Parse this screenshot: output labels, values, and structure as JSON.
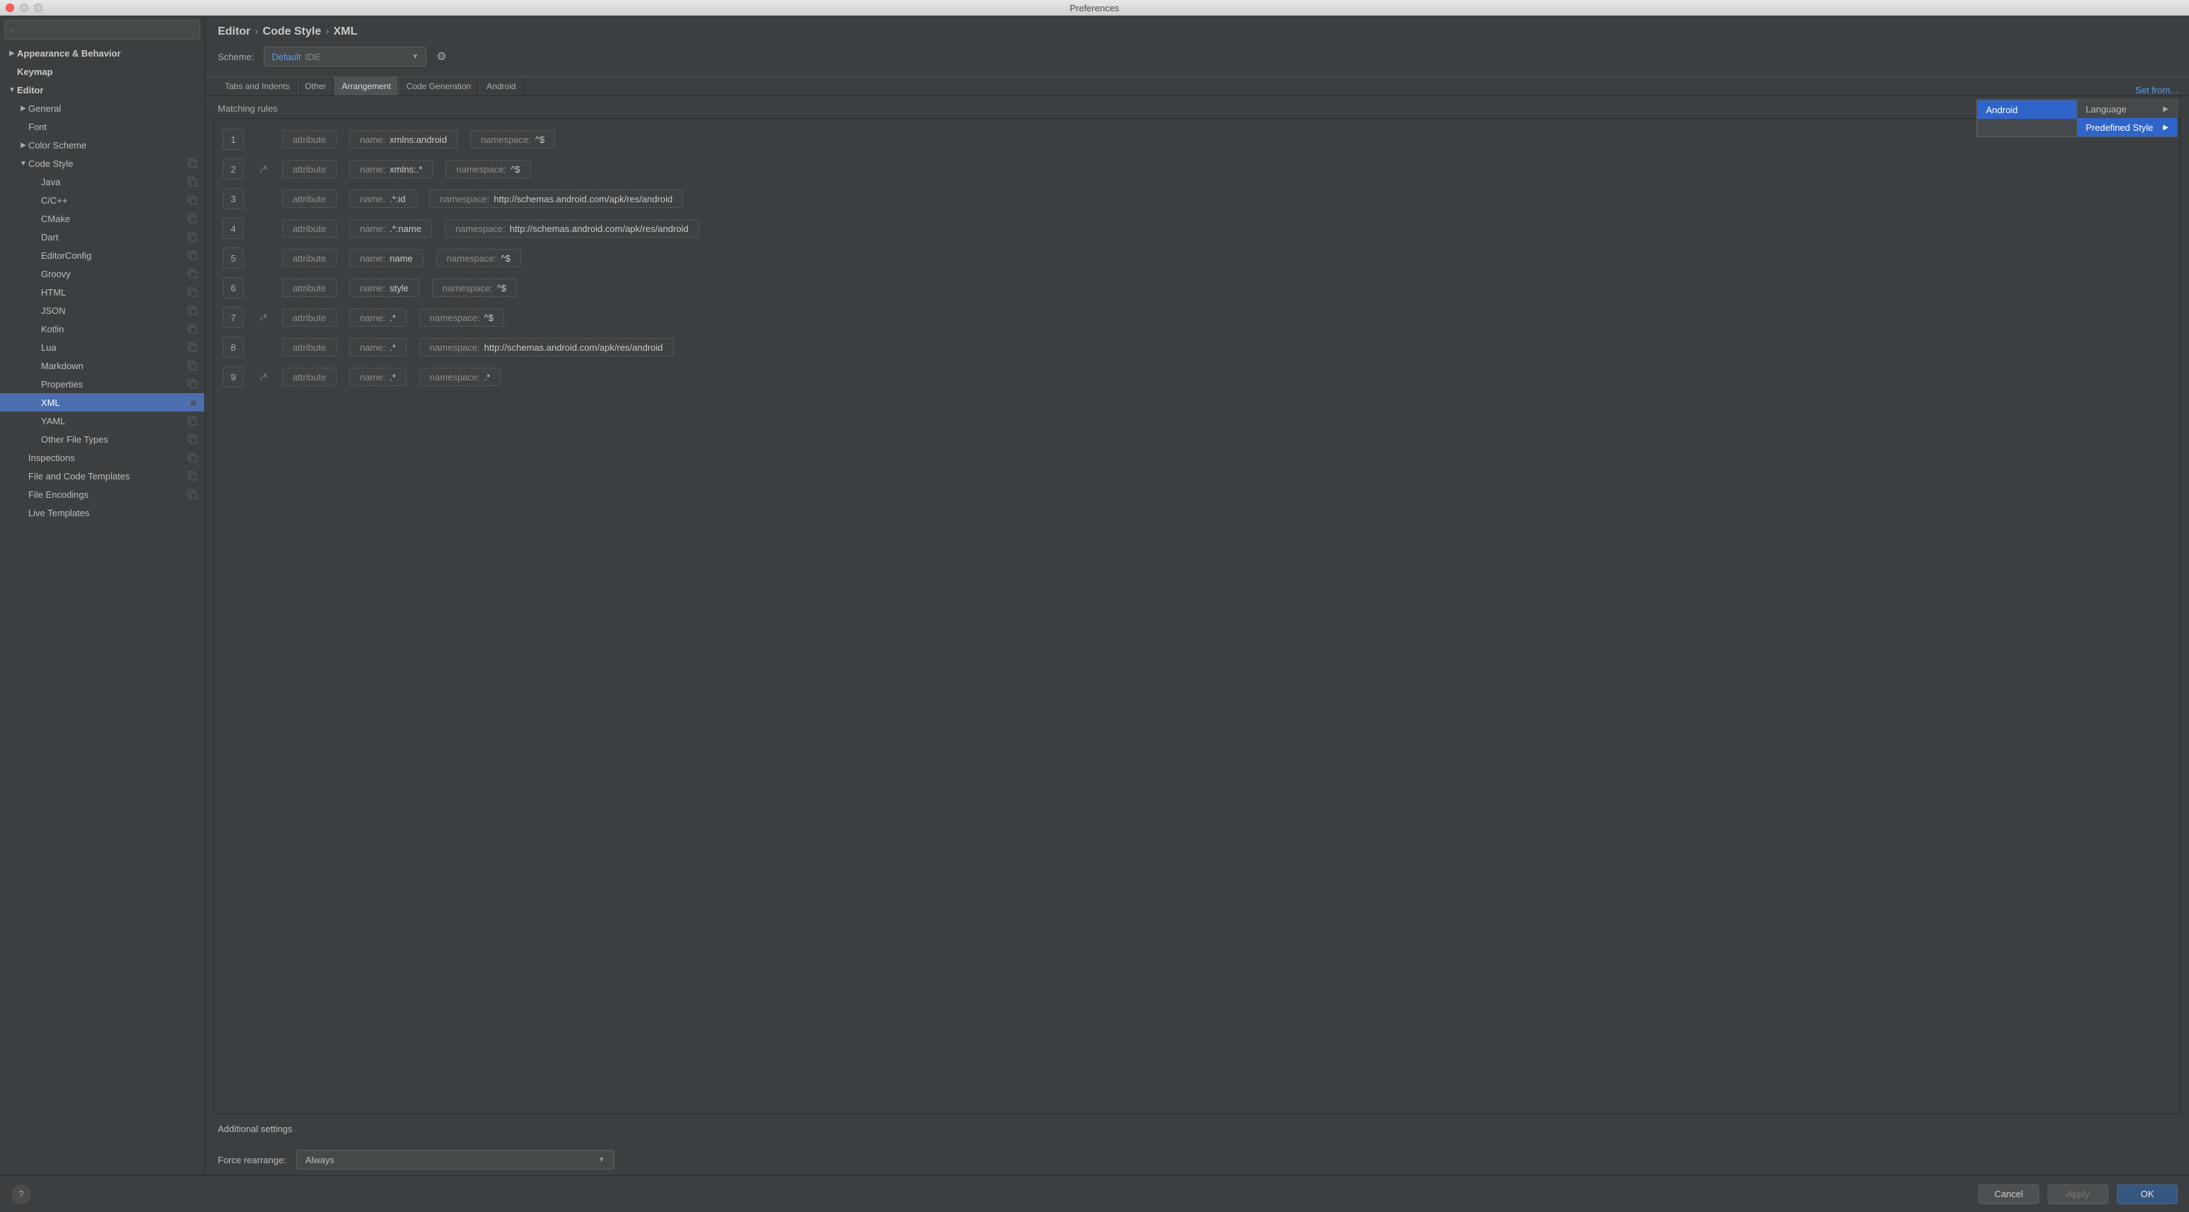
{
  "window": {
    "title": "Preferences"
  },
  "search": {
    "placeholder": "⌕"
  },
  "sidebar": [
    {
      "label": "Appearance & Behavior",
      "indent": 0,
      "bold": true,
      "arrow": "▶",
      "badge": false
    },
    {
      "label": "Keymap",
      "indent": 0,
      "bold": true,
      "arrow": "",
      "badge": false
    },
    {
      "label": "Editor",
      "indent": 0,
      "bold": true,
      "arrow": "▼",
      "badge": false
    },
    {
      "label": "General",
      "indent": 1,
      "bold": false,
      "arrow": "▶",
      "badge": false
    },
    {
      "label": "Font",
      "indent": 1,
      "bold": false,
      "arrow": "",
      "badge": false
    },
    {
      "label": "Color Scheme",
      "indent": 1,
      "bold": false,
      "arrow": "▶",
      "badge": false
    },
    {
      "label": "Code Style",
      "indent": 1,
      "bold": false,
      "arrow": "▼",
      "badge": true
    },
    {
      "label": "Java",
      "indent": 2,
      "bold": false,
      "arrow": "",
      "badge": true
    },
    {
      "label": "C/C++",
      "indent": 2,
      "bold": false,
      "arrow": "",
      "badge": true
    },
    {
      "label": "CMake",
      "indent": 2,
      "bold": false,
      "arrow": "",
      "badge": true
    },
    {
      "label": "Dart",
      "indent": 2,
      "bold": false,
      "arrow": "",
      "badge": true
    },
    {
      "label": "EditorConfig",
      "indent": 2,
      "bold": false,
      "arrow": "",
      "badge": true
    },
    {
      "label": "Groovy",
      "indent": 2,
      "bold": false,
      "arrow": "",
      "badge": true
    },
    {
      "label": "HTML",
      "indent": 2,
      "bold": false,
      "arrow": "",
      "badge": true
    },
    {
      "label": "JSON",
      "indent": 2,
      "bold": false,
      "arrow": "",
      "badge": true
    },
    {
      "label": "Kotlin",
      "indent": 2,
      "bold": false,
      "arrow": "",
      "badge": true
    },
    {
      "label": "Lua",
      "indent": 2,
      "bold": false,
      "arrow": "",
      "badge": true
    },
    {
      "label": "Markdown",
      "indent": 2,
      "bold": false,
      "arrow": "",
      "badge": true
    },
    {
      "label": "Properties",
      "indent": 2,
      "bold": false,
      "arrow": "",
      "badge": true
    },
    {
      "label": "XML",
      "indent": 2,
      "bold": false,
      "arrow": "",
      "badge": true,
      "selected": true
    },
    {
      "label": "YAML",
      "indent": 2,
      "bold": false,
      "arrow": "",
      "badge": true
    },
    {
      "label": "Other File Types",
      "indent": 2,
      "bold": false,
      "arrow": "",
      "badge": true
    },
    {
      "label": "Inspections",
      "indent": 1,
      "bold": false,
      "arrow": "",
      "badge": true
    },
    {
      "label": "File and Code Templates",
      "indent": 1,
      "bold": false,
      "arrow": "",
      "badge": true
    },
    {
      "label": "File Encodings",
      "indent": 1,
      "bold": false,
      "arrow": "",
      "badge": true
    },
    {
      "label": "Live Templates",
      "indent": 1,
      "bold": false,
      "arrow": "",
      "badge": false
    }
  ],
  "breadcrumb": [
    "Editor",
    "Code Style",
    "XML"
  ],
  "scheme": {
    "label": "Scheme:",
    "value": "Default",
    "suffix": "IDE"
  },
  "set_from": "Set from...",
  "menu": {
    "col1": [
      "Language",
      "Predefined Style"
    ],
    "col0": "Android"
  },
  "tabs": [
    "Tabs and Indents",
    "Other",
    "Arrangement",
    "Code Generation",
    "Android"
  ],
  "active_tab": 2,
  "matching_rules_label": "Matching rules",
  "rules": [
    {
      "n": "1",
      "sort": false,
      "type": "attribute",
      "name": "xmlns:android",
      "ns": "^$"
    },
    {
      "n": "2",
      "sort": true,
      "type": "attribute",
      "name": "xmlns:.*",
      "ns": "^$"
    },
    {
      "n": "3",
      "sort": false,
      "type": "attribute",
      "name": ".*:id",
      "ns": "http://schemas.android.com/apk/res/android"
    },
    {
      "n": "4",
      "sort": false,
      "type": "attribute",
      "name": ".*:name",
      "ns": "http://schemas.android.com/apk/res/android"
    },
    {
      "n": "5",
      "sort": false,
      "type": "attribute",
      "name": "name",
      "ns": "^$"
    },
    {
      "n": "6",
      "sort": false,
      "type": "attribute",
      "name": "style",
      "ns": "^$"
    },
    {
      "n": "7",
      "sort": true,
      "type": "attribute",
      "name": ".*",
      "ns": "^$"
    },
    {
      "n": "8",
      "sort": false,
      "type": "attribute",
      "name": ".*",
      "ns": "http://schemas.android.com/apk/res/android"
    },
    {
      "n": "9",
      "sort": true,
      "type": "attribute",
      "name": ".*",
      "ns": ".*"
    }
  ],
  "chip_labels": {
    "name": "name:",
    "namespace": "namespace:"
  },
  "additional_label": "Additional settings",
  "force": {
    "label": "Force rearrange:",
    "value": "Always"
  },
  "buttons": {
    "cancel": "Cancel",
    "apply": "Apply",
    "ok": "OK",
    "help": "?"
  }
}
